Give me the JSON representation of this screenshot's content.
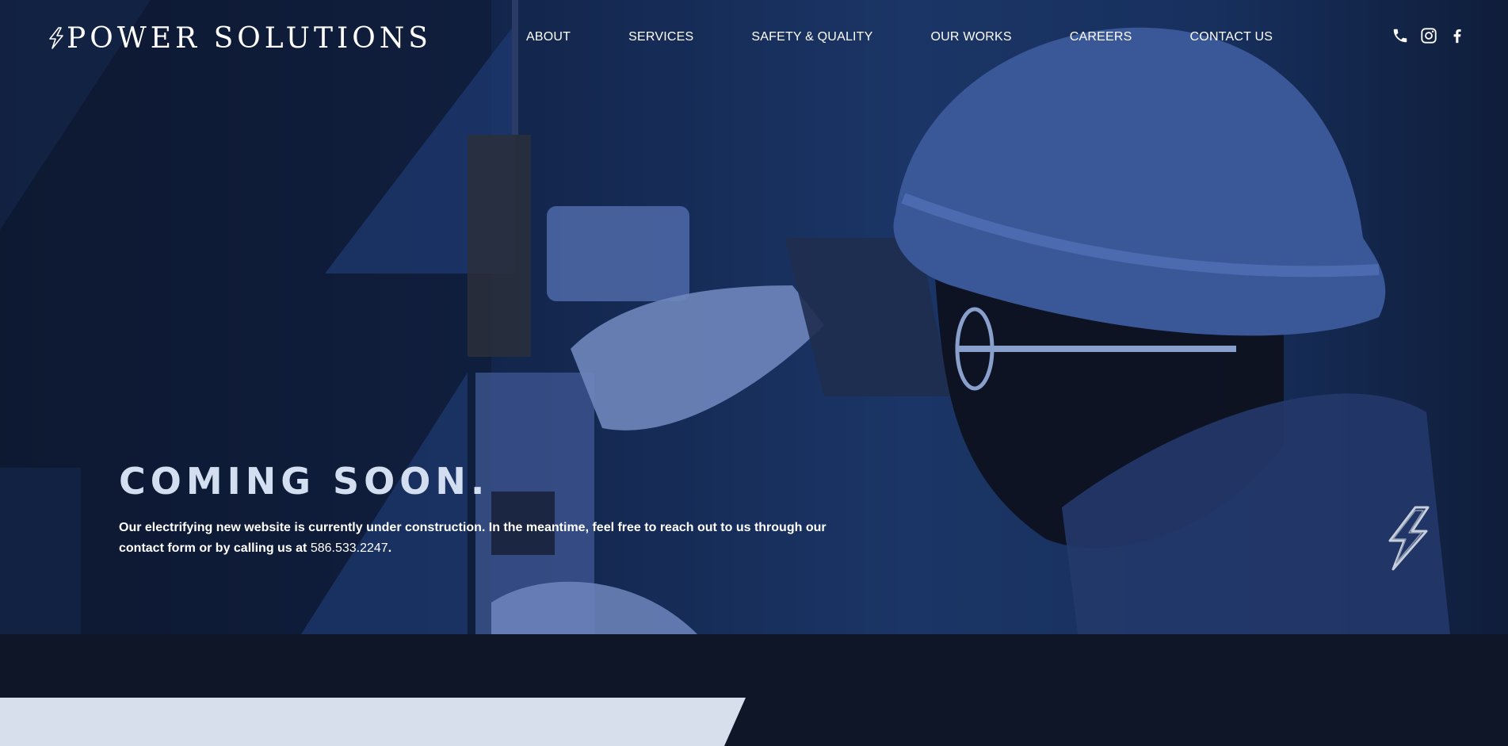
{
  "brand": {
    "name": "POWER SOLUTIONS",
    "logo_icon": "lightning-bolt-icon",
    "accent_color": "#1b3566",
    "light_color": "#d8dfec"
  },
  "nav": {
    "items": [
      {
        "label": "ABOUT"
      },
      {
        "label": "SERVICES"
      },
      {
        "label": "SAFETY & QUALITY"
      },
      {
        "label": "OUR WORKS"
      },
      {
        "label": "CAREERS"
      },
      {
        "label": "CONTACT US"
      }
    ]
  },
  "social": {
    "icons": [
      "phone-icon",
      "instagram-icon",
      "facebook-icon"
    ]
  },
  "hero": {
    "headline": "COMING SOON.",
    "body_prefix": "Our electrifying new website is currently under construction. In the meantime, feel free to reach out to us through our contact form or by calling us at ",
    "phone": "586.533.2247",
    "body_suffix": "."
  }
}
